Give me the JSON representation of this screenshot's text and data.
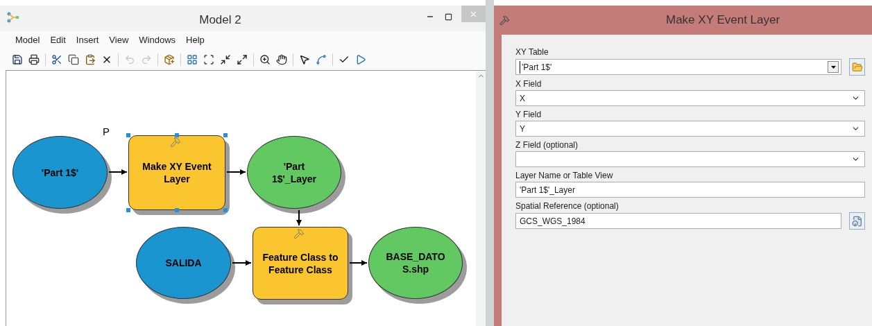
{
  "model_window": {
    "title": "Model 2",
    "menu": [
      "Model",
      "Edit",
      "Insert",
      "View",
      "Windows",
      "Help"
    ],
    "toolbar": [
      {
        "disabled": false
      },
      {
        "disabled": false
      },
      {
        "disabled": false
      },
      {
        "disabled": false
      },
      {
        "disabled": false
      },
      {
        "disabled": false
      },
      {
        "disabled": true
      },
      {
        "disabled": true
      },
      {
        "disabled": false
      },
      {
        "disabled": false
      },
      {
        "disabled": false
      },
      {
        "disabled": false
      },
      {
        "disabled": false
      },
      {
        "disabled": false
      },
      {
        "disabled": false
      },
      {
        "disabled": false
      },
      {
        "disabled": false
      },
      {
        "disabled": false
      },
      {
        "disabled": false
      }
    ],
    "tag": "P",
    "nodes": [
      {
        "kind": "data",
        "label": "'Part 1$'",
        "color": "#1a95cf",
        "selected": false
      },
      {
        "kind": "tool",
        "label": "Make XY Event Layer",
        "color": "#fac52e",
        "selected": true
      },
      {
        "kind": "data",
        "label": "'Part 1$'_Layer",
        "color": "#62c962",
        "selected": false
      },
      {
        "kind": "data",
        "label": "SALIDA",
        "color": "#1a95cf",
        "selected": false
      },
      {
        "kind": "tool",
        "label": "Feature Class to Feature Class",
        "color": "#fac52e",
        "selected": false
      },
      {
        "kind": "data",
        "label": "BASE_DATOS.shp",
        "color": "#62c962",
        "selected": false
      }
    ]
  },
  "dialog": {
    "title": "Make XY Event Layer",
    "fields": [
      {
        "kind": "combo",
        "label": "XY Table",
        "value": "'Part 1$'",
        "browse": true
      },
      {
        "kind": "dropdown",
        "label": "X Field",
        "value": "X",
        "browse": false
      },
      {
        "kind": "dropdown",
        "label": "Y Field",
        "value": "Y",
        "browse": false
      },
      {
        "kind": "dropdown",
        "label": "Z Field (optional)",
        "browse": false
      },
      {
        "kind": "text",
        "label": "Layer Name or Table View",
        "value": "'Part 1$'_Layer",
        "browse": false
      },
      {
        "kind": "text",
        "label": "Spatial Reference (optional)",
        "value": "GCS_WGS_1984",
        "browse": true
      }
    ]
  }
}
